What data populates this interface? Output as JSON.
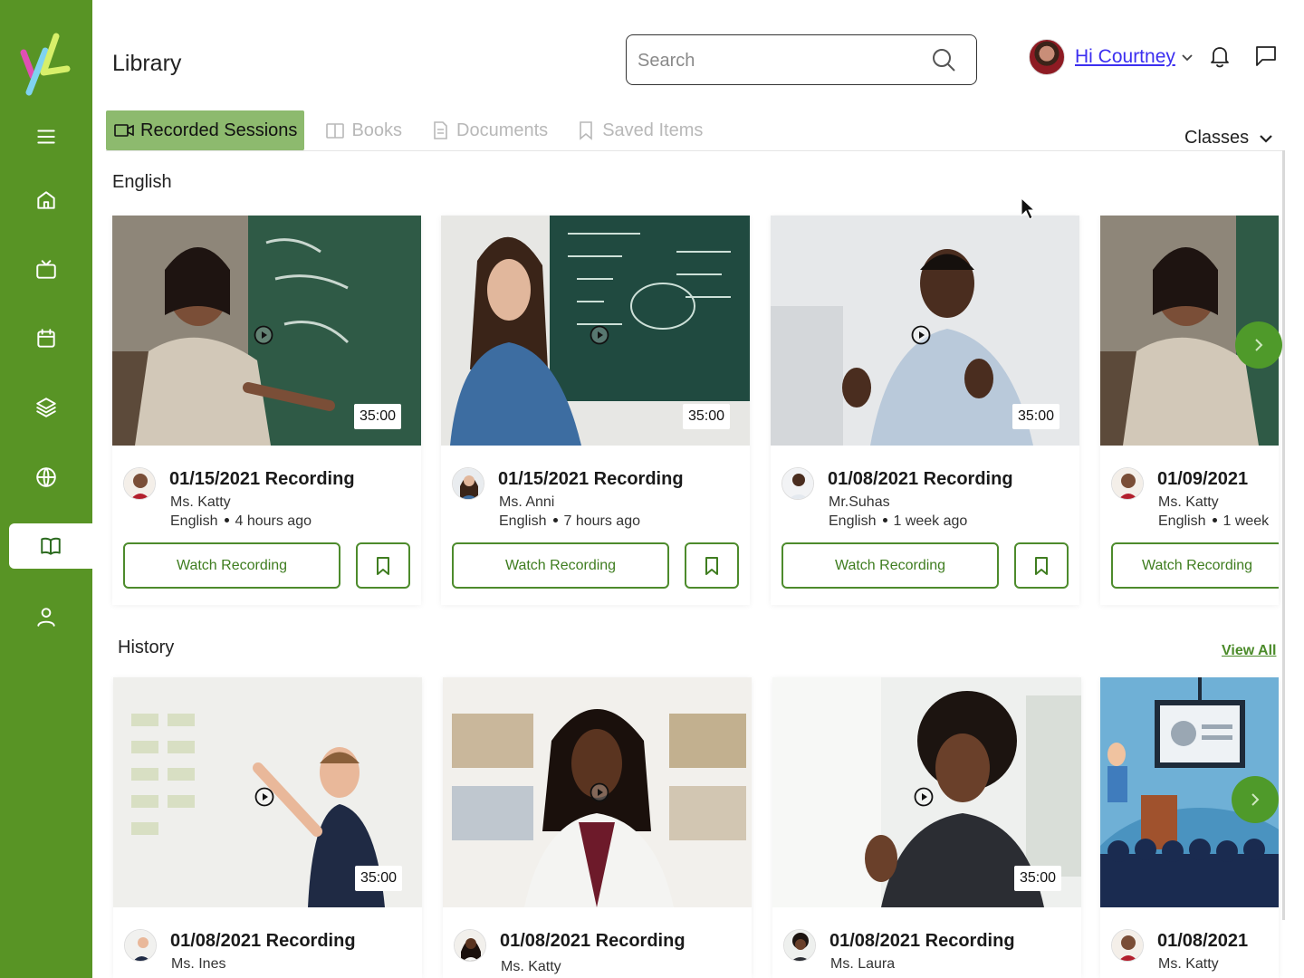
{
  "app": {
    "brand_colors": {
      "sidebar": "#589425",
      "accent": "#4d8b2c",
      "tab_active": "#8dba6e",
      "link": "#3c2ff0"
    }
  },
  "sidebar": {
    "items": [
      {
        "name": "menu",
        "icon": "hamburger-icon"
      },
      {
        "name": "home",
        "icon": "home-icon"
      },
      {
        "name": "live",
        "icon": "tv-icon"
      },
      {
        "name": "calendar",
        "icon": "calendar-icon"
      },
      {
        "name": "courses",
        "icon": "layers-icon"
      },
      {
        "name": "global",
        "icon": "globe-icon"
      },
      {
        "name": "library",
        "icon": "book-open-icon",
        "active": true
      },
      {
        "name": "profile",
        "icon": "user-icon"
      }
    ]
  },
  "header": {
    "title": "Library",
    "search_placeholder": "Search",
    "greeting": "Hi Courtney"
  },
  "tabs": [
    {
      "label": "Recorded Sessions",
      "icon": "video-icon",
      "active": true
    },
    {
      "label": "Books",
      "icon": "book-icon",
      "active": false
    },
    {
      "label": "Documents",
      "icon": "document-icon",
      "active": false
    },
    {
      "label": "Saved Items",
      "icon": "bookmark-icon",
      "active": false
    }
  ],
  "filter": {
    "label": "Classes"
  },
  "sections": {
    "english": {
      "title": "English",
      "cards": [
        {
          "title": "01/15/2021  Recording",
          "teacher": "Ms. Katty",
          "subject": "English",
          "time": "4 hours ago",
          "duration": "35:00",
          "button": "Watch Recording"
        },
        {
          "title": "01/15/2021 Recording",
          "teacher": "Ms. Anni",
          "subject": "English",
          "time": "7 hours ago",
          "duration": "35:00",
          "button": "Watch Recording"
        },
        {
          "title": "01/08/2021  Recording",
          "teacher": "Mr.Suhas",
          "subject": "English",
          "time": "1 week ago",
          "duration": "35:00",
          "button": "Watch Recording"
        },
        {
          "title": "01/09/2021",
          "teacher": "Ms. Katty",
          "subject": "English",
          "time": "1 week",
          "duration": "",
          "button": "Watch Recording"
        }
      ]
    },
    "history": {
      "title": "History",
      "view_all": "View All",
      "cards": [
        {
          "title": "01/08/2021  Recording",
          "teacher": "Ms. Ines",
          "duration": "35:00"
        },
        {
          "title": "01/08/2021 Recording",
          "teacher": "Ms. Katty",
          "duration": ""
        },
        {
          "title": "01/08/2021  Recording",
          "teacher": "Ms. Laura",
          "duration": "35:00"
        },
        {
          "title": "01/08/2021",
          "teacher": "Ms. Katty",
          "duration": ""
        }
      ]
    }
  }
}
